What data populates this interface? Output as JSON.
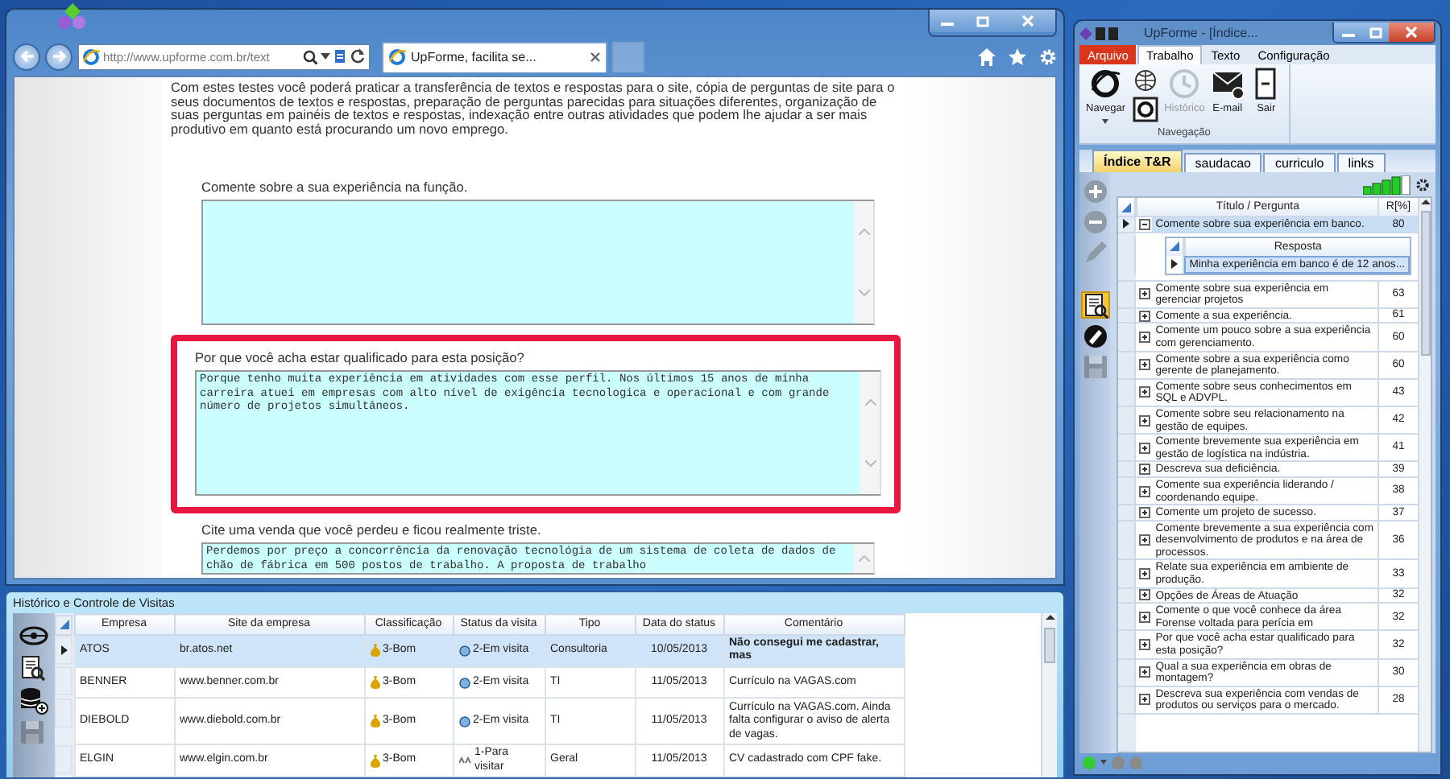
{
  "browser": {
    "address": "http://www.upforme.com.br/text",
    "tab_title": "UpForme, facilita se...",
    "intro": "Com estes testes você poderá praticar a transferência de textos e respostas para o site, cópia de perguntas de site para o seus documentos de textos e respostas, preparação de perguntas parecidas para situações diferentes, organização de suas perguntas em painéis de textos e respostas, indexação entre outras atividades que podem lhe ajudar a ser mais produtivo em quanto está procurando um novo emprego.",
    "questions": [
      {
        "label": "Comente sobre a sua experiência na função.",
        "highlighted": false
      },
      {
        "label": "Por que você acha estar qualificado para esta posição?",
        "answer": "Porque tenho muita experiência em atividades com esse perfil. Nos últimos 15 anos de minha carreira atuei em empresas com alto nível de exigência tecnologica e operacional e com grande número de projetos simultâneos.",
        "highlighted": true
      },
      {
        "label": "Cite uma venda que você perdeu e ficou realmente triste.",
        "answer": "Perdemos por preço a concorrência da renovação tecnológia de um sistema de coleta de dados de chão de fábrica em 500 postos de trabalho. A proposta de trabalho",
        "highlighted": false
      }
    ]
  },
  "visits": {
    "title": "Histórico e Controle de Visitas",
    "tools": [
      {
        "kind": "hub",
        "disabled": false
      },
      {
        "kind": "doc-search",
        "disabled": false
      },
      {
        "kind": "db-add",
        "disabled": false
      },
      {
        "kind": "save",
        "disabled": true
      }
    ],
    "columns": [
      "Empresa",
      "Site da empresa",
      "Classificação",
      "Status da visita",
      "Tipo",
      "Data do status",
      "Comentário"
    ],
    "rows": [
      {
        "empresa": "ATOS",
        "site": "br.atos.net",
        "classificacao": "3-Bom",
        "status": "2-Em visita",
        "kind": "visiting",
        "tipo": "Consultoria",
        "data": "10/05/2013",
        "comentario": "Não consegui me cadastrar, mas",
        "selected": true
      },
      {
        "empresa": "BENNER",
        "site": "www.benner.com.br",
        "classificacao": "3-Bom",
        "status": "2-Em visita",
        "kind": "visiting",
        "tipo": "TI",
        "data": "11/05/2013",
        "comentario": "Currículo na VAGAS.com",
        "selected": false
      },
      {
        "empresa": "DIEBOLD",
        "site": "www.diebold.com.br",
        "classificacao": "3-Bom",
        "status": "2-Em visita",
        "kind": "visiting",
        "tipo": "TI",
        "data": "11/05/2013",
        "comentario": "Currículo na VAGAS.com. Ainda falta configurar o aviso de alerta de vagas.",
        "selected": false
      },
      {
        "empresa": "ELGIN",
        "site": "www.elgin.com.br",
        "classificacao": "3-Bom",
        "status": "1-Para visitar",
        "kind": "planned",
        "tipo": "Geral",
        "data": "11/05/2013",
        "comentario": "CV cadastrado com CPF fake.",
        "selected": false
      }
    ]
  },
  "app": {
    "title": "UpForme - [Índice...",
    "menu_tabs": [
      {
        "label": "Arquivo",
        "kind": "file",
        "selected": false
      },
      {
        "label": "Trabalho",
        "kind": "tab",
        "selected": true
      },
      {
        "label": "Texto",
        "kind": "tab",
        "selected": false
      },
      {
        "label": "Configuração",
        "kind": "tab",
        "selected": false
      }
    ],
    "ribbon_buttons": [
      {
        "label": "Navegar",
        "kind": "navigate",
        "disabled": false
      },
      {
        "kind": "web-pair",
        "disabled": false
      },
      {
        "label": "Histórico",
        "kind": "history",
        "disabled": true
      },
      {
        "label": "E-mail",
        "kind": "email",
        "disabled": false
      },
      {
        "label": "Sair",
        "kind": "exit",
        "disabled": false
      }
    ],
    "ribbon_group": "Navegação",
    "doc_tabs": [
      {
        "label": "Índice T&R",
        "selected": true
      },
      {
        "label": "saudacao",
        "selected": false
      },
      {
        "label": "curriculo",
        "selected": false
      },
      {
        "label": "links",
        "selected": false
      }
    ],
    "side_tools": [
      {
        "kind": "add",
        "selected": false,
        "disabled": false
      },
      {
        "kind": "remove",
        "selected": false,
        "disabled": false
      },
      {
        "kind": "edit",
        "selected": false,
        "disabled": false
      },
      {
        "kind": "doc-search",
        "selected": true,
        "disabled": false
      },
      {
        "kind": "eraser",
        "selected": false,
        "disabled": false
      },
      {
        "kind": "save",
        "selected": false,
        "disabled": true
      }
    ],
    "columns": [
      "Título / Pergunta",
      "R[%]"
    ],
    "rows": [
      {
        "title": "Comente sobre sua experiência em banco.",
        "r": "80",
        "selected": true,
        "expanded": true,
        "answer_header": "Resposta",
        "answer": "Minha experiência em banco é de 12 anos..."
      },
      {
        "title": "Comente sobre sua experiência em gerenciar projetos",
        "r": "63",
        "selected": false,
        "expanded": false
      },
      {
        "title": "Comente a sua experiência.",
        "r": "61",
        "selected": false,
        "expanded": false
      },
      {
        "title": "Comente um pouco sobre a sua experiência com gerenciamento.",
        "r": "60",
        "selected": false,
        "expanded": false
      },
      {
        "title": "Comente sobre a sua experiência como gerente de planejamento.",
        "r": "60",
        "selected": false,
        "expanded": false
      },
      {
        "title": "Comente sobre seus conhecimentos em SQL e ADVPL.",
        "r": "43",
        "selected": false,
        "expanded": false
      },
      {
        "title": "Comente sobre seu relacionamento na gestão de equipes.",
        "r": "42",
        "selected": false,
        "expanded": false
      },
      {
        "title": "Comente brevemente sua experiência em gestão de logística na indústria.",
        "r": "41",
        "selected": false,
        "expanded": false
      },
      {
        "title": "Descreva sua deficiência.",
        "r": "39",
        "selected": false,
        "expanded": false
      },
      {
        "title": "Comente sua experiência liderando / coordenando equipe.",
        "r": "38",
        "selected": false,
        "expanded": false
      },
      {
        "title": "Comente um projeto de sucesso.",
        "r": "37",
        "selected": false,
        "expanded": false
      },
      {
        "title": "Comente brevemente a sua experiência com desenvolvimento de produtos e na área de processos.",
        "r": "36",
        "selected": false,
        "expanded": false
      },
      {
        "title": "Relate sua experiência em ambiente de produção.",
        "r": "33",
        "selected": false,
        "expanded": false
      },
      {
        "title": "Opções de Áreas de Atuação",
        "r": "32",
        "selected": false,
        "expanded": false
      },
      {
        "title": "Comente o que você conhece da área Forense voltada para perícia em",
        "r": "32",
        "selected": false,
        "expanded": false
      },
      {
        "title": "Por que você acha estar qualificado para esta posição?",
        "r": "32",
        "selected": false,
        "expanded": false
      },
      {
        "title": "Qual a sua experiência em obras de montagem?",
        "r": "30",
        "selected": false,
        "expanded": false
      },
      {
        "title": "Descreva sua experiência com vendas de produtos ou serviços para o mercado.",
        "r": "28",
        "selected": false,
        "expanded": false
      }
    ],
    "status_lights": [
      {
        "color": "#33cc33"
      },
      {
        "color": "#8a8a8a"
      },
      {
        "color": "#8a8a8a"
      }
    ]
  }
}
